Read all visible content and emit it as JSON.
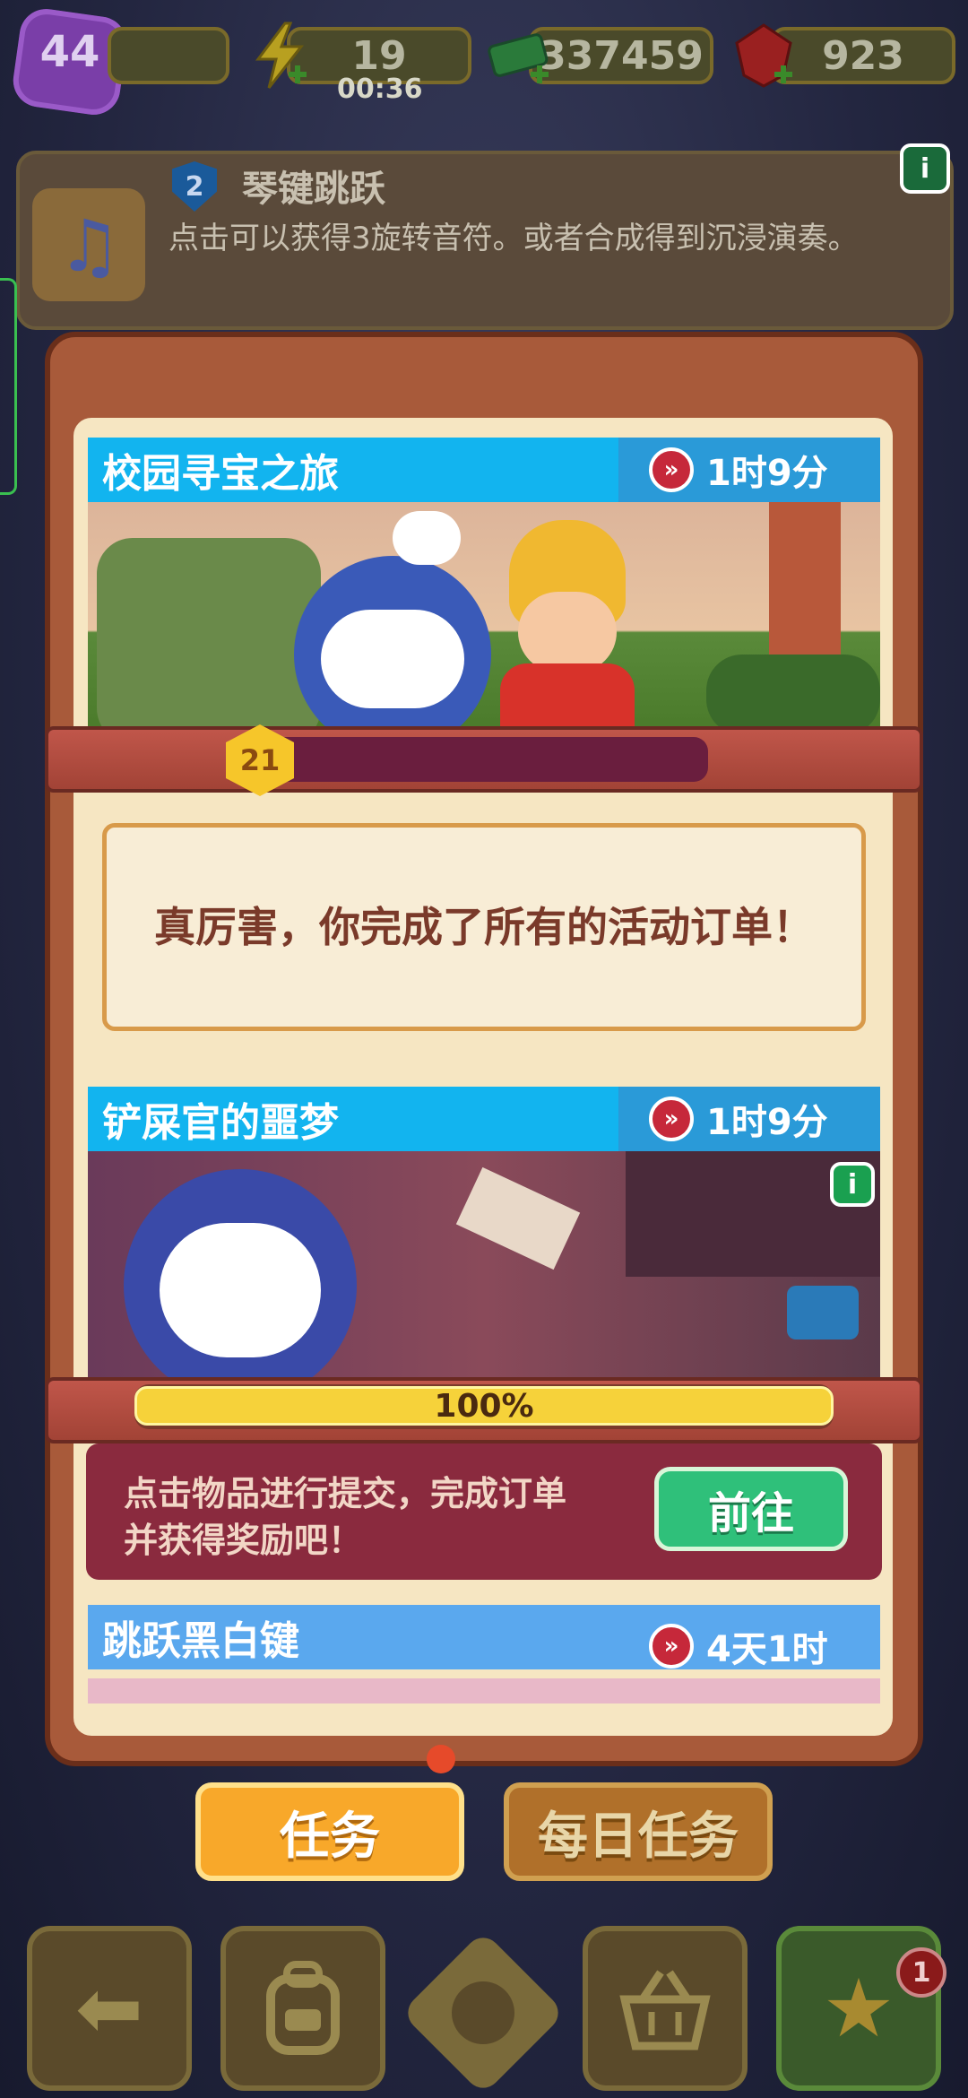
{
  "topbar": {
    "level": "44",
    "energy": "19",
    "energy_timer": "00:36",
    "cash": "337459",
    "gems": "923"
  },
  "infobar": {
    "badge": "2",
    "title": "琴键跳跃",
    "description": "点击可以获得3旋转音符。或者合成得到沉浸演奏。"
  },
  "modal": {
    "title": "任务"
  },
  "events": [
    {
      "name": "校园寻宝之旅",
      "timer": "1时9分",
      "level": "21",
      "message": "真厉害，你完成了所有的活动订单！"
    },
    {
      "name": "铲屎官的噩梦",
      "timer": "1时9分",
      "progress_label": "100%",
      "progress": 1.0,
      "instruction": "点击物品进行提交，完成订单并获得奖励吧！",
      "button": "前往"
    },
    {
      "name": "跳跃黑白键",
      "timer": "4天1时"
    }
  ],
  "tabs": [
    {
      "label": "任务",
      "active": true
    },
    {
      "label": "每日任务",
      "active": false
    }
  ],
  "nav": {
    "badge_count": "1",
    "icons": [
      "back-arrow-icon",
      "backpack-icon",
      "bear-icon",
      "basket-icon",
      "star-icon"
    ]
  }
}
